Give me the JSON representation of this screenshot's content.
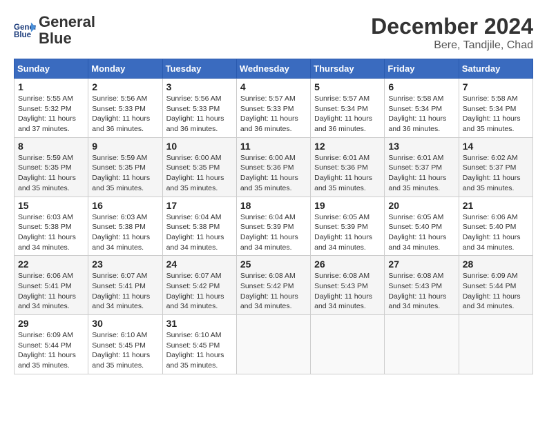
{
  "header": {
    "logo_line1": "General",
    "logo_line2": "Blue",
    "title": "December 2024",
    "location": "Bere, Tandjile, Chad"
  },
  "weekdays": [
    "Sunday",
    "Monday",
    "Tuesday",
    "Wednesday",
    "Thursday",
    "Friday",
    "Saturday"
  ],
  "weeks": [
    [
      {
        "day": "1",
        "sunrise": "5:55 AM",
        "sunset": "5:32 PM",
        "daylight": "11 hours and 37 minutes."
      },
      {
        "day": "2",
        "sunrise": "5:56 AM",
        "sunset": "5:33 PM",
        "daylight": "11 hours and 36 minutes."
      },
      {
        "day": "3",
        "sunrise": "5:56 AM",
        "sunset": "5:33 PM",
        "daylight": "11 hours and 36 minutes."
      },
      {
        "day": "4",
        "sunrise": "5:57 AM",
        "sunset": "5:33 PM",
        "daylight": "11 hours and 36 minutes."
      },
      {
        "day": "5",
        "sunrise": "5:57 AM",
        "sunset": "5:34 PM",
        "daylight": "11 hours and 36 minutes."
      },
      {
        "day": "6",
        "sunrise": "5:58 AM",
        "sunset": "5:34 PM",
        "daylight": "11 hours and 36 minutes."
      },
      {
        "day": "7",
        "sunrise": "5:58 AM",
        "sunset": "5:34 PM",
        "daylight": "11 hours and 35 minutes."
      }
    ],
    [
      {
        "day": "8",
        "sunrise": "5:59 AM",
        "sunset": "5:35 PM",
        "daylight": "11 hours and 35 minutes."
      },
      {
        "day": "9",
        "sunrise": "5:59 AM",
        "sunset": "5:35 PM",
        "daylight": "11 hours and 35 minutes."
      },
      {
        "day": "10",
        "sunrise": "6:00 AM",
        "sunset": "5:35 PM",
        "daylight": "11 hours and 35 minutes."
      },
      {
        "day": "11",
        "sunrise": "6:00 AM",
        "sunset": "5:36 PM",
        "daylight": "11 hours and 35 minutes."
      },
      {
        "day": "12",
        "sunrise": "6:01 AM",
        "sunset": "5:36 PM",
        "daylight": "11 hours and 35 minutes."
      },
      {
        "day": "13",
        "sunrise": "6:01 AM",
        "sunset": "5:37 PM",
        "daylight": "11 hours and 35 minutes."
      },
      {
        "day": "14",
        "sunrise": "6:02 AM",
        "sunset": "5:37 PM",
        "daylight": "11 hours and 35 minutes."
      }
    ],
    [
      {
        "day": "15",
        "sunrise": "6:03 AM",
        "sunset": "5:38 PM",
        "daylight": "11 hours and 34 minutes."
      },
      {
        "day": "16",
        "sunrise": "6:03 AM",
        "sunset": "5:38 PM",
        "daylight": "11 hours and 34 minutes."
      },
      {
        "day": "17",
        "sunrise": "6:04 AM",
        "sunset": "5:38 PM",
        "daylight": "11 hours and 34 minutes."
      },
      {
        "day": "18",
        "sunrise": "6:04 AM",
        "sunset": "5:39 PM",
        "daylight": "11 hours and 34 minutes."
      },
      {
        "day": "19",
        "sunrise": "6:05 AM",
        "sunset": "5:39 PM",
        "daylight": "11 hours and 34 minutes."
      },
      {
        "day": "20",
        "sunrise": "6:05 AM",
        "sunset": "5:40 PM",
        "daylight": "11 hours and 34 minutes."
      },
      {
        "day": "21",
        "sunrise": "6:06 AM",
        "sunset": "5:40 PM",
        "daylight": "11 hours and 34 minutes."
      }
    ],
    [
      {
        "day": "22",
        "sunrise": "6:06 AM",
        "sunset": "5:41 PM",
        "daylight": "11 hours and 34 minutes."
      },
      {
        "day": "23",
        "sunrise": "6:07 AM",
        "sunset": "5:41 PM",
        "daylight": "11 hours and 34 minutes."
      },
      {
        "day": "24",
        "sunrise": "6:07 AM",
        "sunset": "5:42 PM",
        "daylight": "11 hours and 34 minutes."
      },
      {
        "day": "25",
        "sunrise": "6:08 AM",
        "sunset": "5:42 PM",
        "daylight": "11 hours and 34 minutes."
      },
      {
        "day": "26",
        "sunrise": "6:08 AM",
        "sunset": "5:43 PM",
        "daylight": "11 hours and 34 minutes."
      },
      {
        "day": "27",
        "sunrise": "6:08 AM",
        "sunset": "5:43 PM",
        "daylight": "11 hours and 34 minutes."
      },
      {
        "day": "28",
        "sunrise": "6:09 AM",
        "sunset": "5:44 PM",
        "daylight": "11 hours and 34 minutes."
      }
    ],
    [
      {
        "day": "29",
        "sunrise": "6:09 AM",
        "sunset": "5:44 PM",
        "daylight": "11 hours and 35 minutes."
      },
      {
        "day": "30",
        "sunrise": "6:10 AM",
        "sunset": "5:45 PM",
        "daylight": "11 hours and 35 minutes."
      },
      {
        "day": "31",
        "sunrise": "6:10 AM",
        "sunset": "5:45 PM",
        "daylight": "11 hours and 35 minutes."
      },
      null,
      null,
      null,
      null
    ]
  ],
  "labels": {
    "sunrise_prefix": "Sunrise: ",
    "sunset_prefix": "Sunset: ",
    "daylight_prefix": "Daylight: "
  }
}
